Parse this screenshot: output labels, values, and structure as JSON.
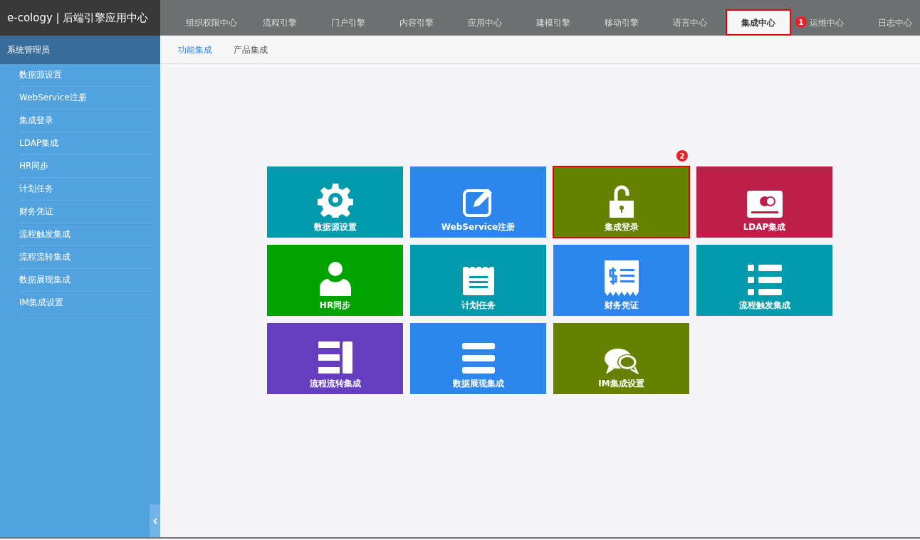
{
  "app_title": "e-cology | 后端引擎应用中心",
  "tabs": [
    {
      "label": "组织权限中心",
      "selected": false
    },
    {
      "label": "流程引擎",
      "selected": false
    },
    {
      "label": "门户引擎",
      "selected": false
    },
    {
      "label": "内容引擎",
      "selected": false
    },
    {
      "label": "应用中心",
      "selected": false
    },
    {
      "label": "建模引擎",
      "selected": false
    },
    {
      "label": "移动引擎",
      "selected": false
    },
    {
      "label": "语言中心",
      "selected": false
    },
    {
      "label": "集成中心",
      "selected": true,
      "highlighted": true,
      "marker": "1"
    },
    {
      "label": "运维中心",
      "selected": false
    },
    {
      "label": "日志中心",
      "selected": false
    }
  ],
  "sidebar": {
    "user": "系统管理员",
    "items": [
      {
        "label": "数据源设置"
      },
      {
        "label": "WebService注册"
      },
      {
        "label": "集成登录"
      },
      {
        "label": "LDAP集成"
      },
      {
        "label": "HR同步"
      },
      {
        "label": "计划任务"
      },
      {
        "label": "财务凭证"
      },
      {
        "label": "流程触发集成"
      },
      {
        "label": "流程流转集成"
      },
      {
        "label": "数据展现集成"
      },
      {
        "label": "IM集成设置"
      }
    ]
  },
  "subtabs": [
    {
      "label": "功能集成",
      "selected": true
    },
    {
      "label": "产品集成",
      "selected": false
    }
  ],
  "tiles": [
    {
      "label": "数据源设置",
      "kind": "gear",
      "color": "#029aad",
      "highlighted": false
    },
    {
      "label": "WebService注册",
      "kind": "edit",
      "color": "#2d86ec",
      "highlighted": false
    },
    {
      "label": "集成登录",
      "kind": "unlock",
      "color": "#668000",
      "highlighted": true,
      "marker": "2"
    },
    {
      "label": "LDAP集成",
      "kind": "card",
      "color": "#be1e4a",
      "highlighted": false
    },
    {
      "label": "HR同步",
      "kind": "user",
      "color": "#00a300",
      "highlighted": false
    },
    {
      "label": "计划任务",
      "kind": "notepad",
      "color": "#029aad",
      "highlighted": false
    },
    {
      "label": "财务凭证",
      "kind": "receipt",
      "color": "#2d86ec",
      "highlighted": false
    },
    {
      "label": "流程触发集成",
      "kind": "list",
      "color": "#029aad",
      "highlighted": false
    },
    {
      "label": "流程流转集成",
      "kind": "split",
      "color": "#643ebf",
      "highlighted": false
    },
    {
      "label": "数据展现集成",
      "kind": "bars",
      "color": "#2d86ec",
      "highlighted": false
    },
    {
      "label": "IM集成设置",
      "kind": "chat",
      "color": "#668000",
      "highlighted": false
    }
  ]
}
